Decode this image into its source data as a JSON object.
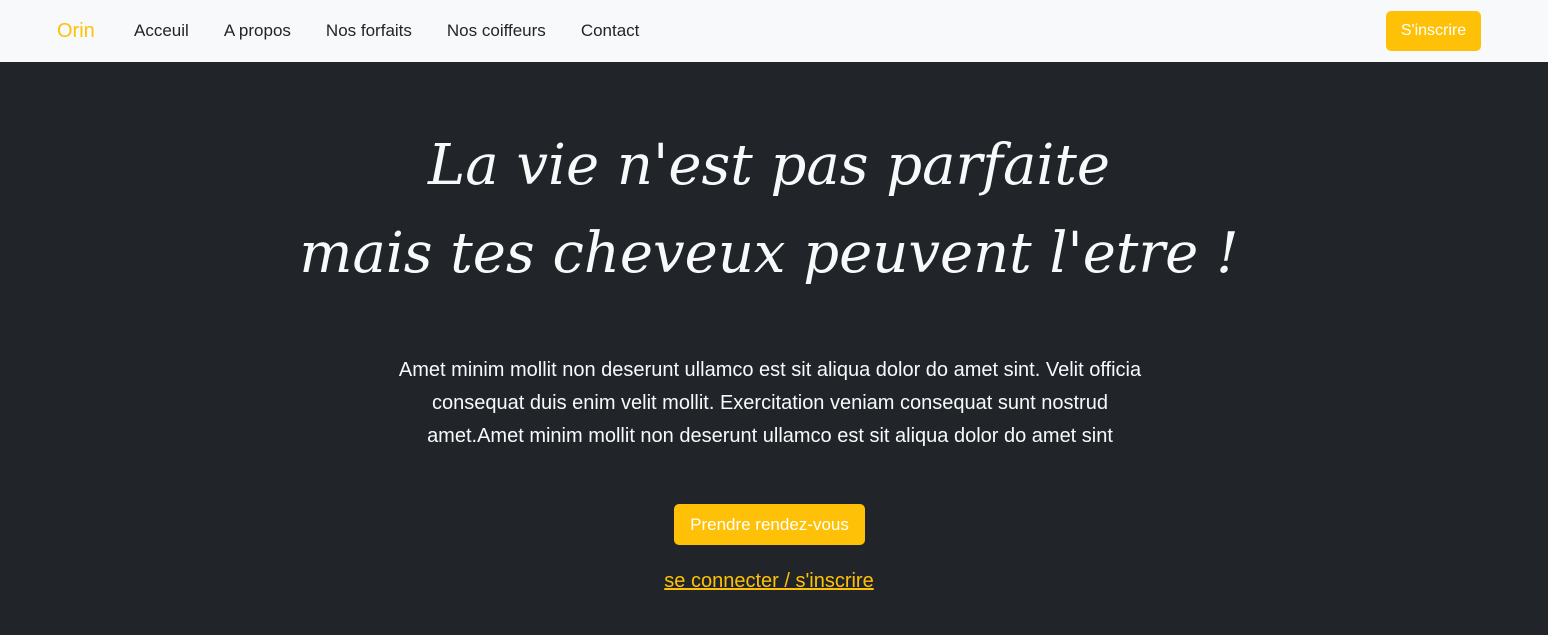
{
  "navbar": {
    "brand": "Orin",
    "links": [
      {
        "label": "Acceuil"
      },
      {
        "label": "A propos"
      },
      {
        "label": "Nos forfaits"
      },
      {
        "label": "Nos coiffeurs"
      },
      {
        "label": "Contact"
      }
    ],
    "signup_label": "S'inscrire"
  },
  "hero": {
    "title_line1": "La vie n'est pas parfaite",
    "title_line2": "mais tes cheveux peuvent l'etre !",
    "text_line1": "Amet minim mollit non deserunt ullamco est sit aliqua dolor do amet sint. Velit officia",
    "text_line2": "consequat duis enim velit mollit. Exercitation veniam consequat sunt nostrud",
    "text_line3": "amet.Amet minim mollit non deserunt ullamco est sit aliqua dolor do amet sint",
    "cta_label": "Prendre rendez-vous",
    "login_link": "se connecter / s'inscrire"
  },
  "colors": {
    "accent": "#ffc107",
    "navbar_bg": "#f8f9fa",
    "hero_bg": "#212529",
    "text_light": "#f8f9fa"
  }
}
